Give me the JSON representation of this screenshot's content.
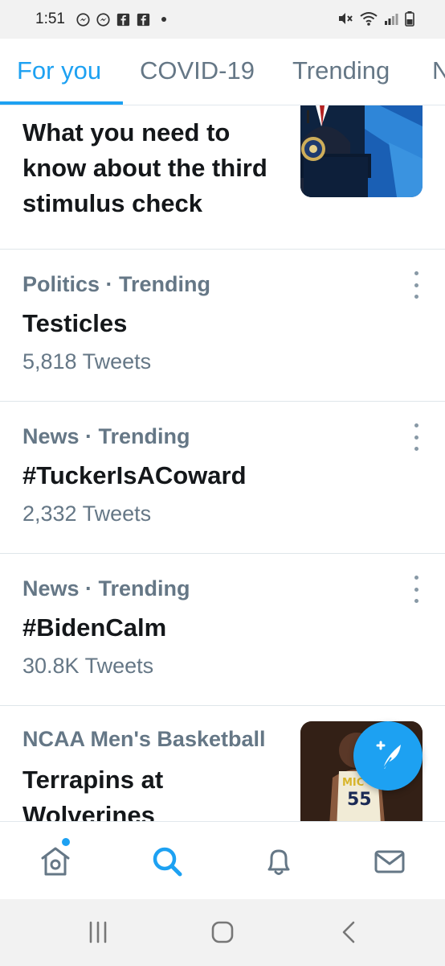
{
  "status_bar": {
    "time": "1:51"
  },
  "tabs": [
    {
      "label": "For you",
      "active": true
    },
    {
      "label": "COVID-19",
      "active": false
    },
    {
      "label": "Trending",
      "active": false
    },
    {
      "label": "N",
      "active": false
    }
  ],
  "feed": {
    "featured": {
      "headline_lines": [
        "What you need to",
        "know about the third",
        "stimulus check"
      ]
    },
    "trends": [
      {
        "meta": "Politics · Trending",
        "topic": "Testicles",
        "count": "5,818 Tweets"
      },
      {
        "meta": "News · Trending",
        "topic": "#TuckerIsACoward",
        "count": "2,332 Tweets"
      },
      {
        "meta": "News · Trending",
        "topic": "#BidenCalm",
        "count": "30.8K Tweets"
      }
    ],
    "sports": {
      "meta": "NCAA Men's Basketball",
      "headline_lines": [
        "Terrapins at",
        "Wolverines"
      ],
      "jersey_text": "MIC",
      "jersey_number": "55"
    }
  },
  "bottom_nav": [
    {
      "name": "home",
      "icon": "home-icon",
      "active": false,
      "badge": true
    },
    {
      "name": "search",
      "icon": "search-icon",
      "active": true,
      "badge": false
    },
    {
      "name": "notifications",
      "icon": "bell-icon",
      "active": false,
      "badge": false
    },
    {
      "name": "messages",
      "icon": "mail-icon",
      "active": false,
      "badge": false
    }
  ],
  "colors": {
    "accent": "#1da1f2",
    "secondary_text": "#657786",
    "primary_text": "#14171a"
  }
}
